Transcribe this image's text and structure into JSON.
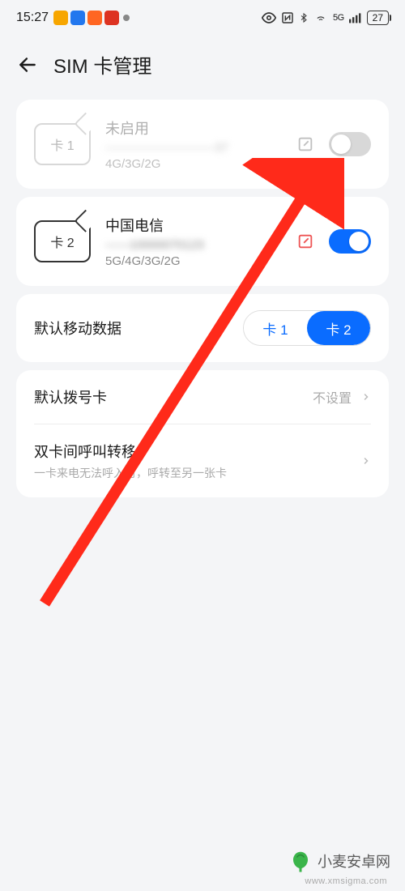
{
  "statusBar": {
    "time": "15:27",
    "signal5g": "5G",
    "battery": "27"
  },
  "header": {
    "title": "SIM 卡管理"
  },
  "sim1": {
    "chip_label": "卡 1",
    "title": "未启用",
    "number": "—————————37",
    "network": "4G/3G/2G",
    "enabled": false
  },
  "sim2": {
    "chip_label": "卡 2",
    "title": "中国电信",
    "number": "——10000070123",
    "network": "5G/4G/3G/2G",
    "enabled": true
  },
  "defaultData": {
    "label": "默认移动数据",
    "option1": "卡 1",
    "option2": "卡 2"
  },
  "defaultCall": {
    "label": "默认拨号卡",
    "value": "不设置"
  },
  "callForward": {
    "label": "双卡间呼叫转移",
    "sub": "一卡来电无法呼入时，呼转至另一张卡"
  },
  "watermark": {
    "text": "小麦安卓网",
    "url": "www.xmsigma.com"
  }
}
